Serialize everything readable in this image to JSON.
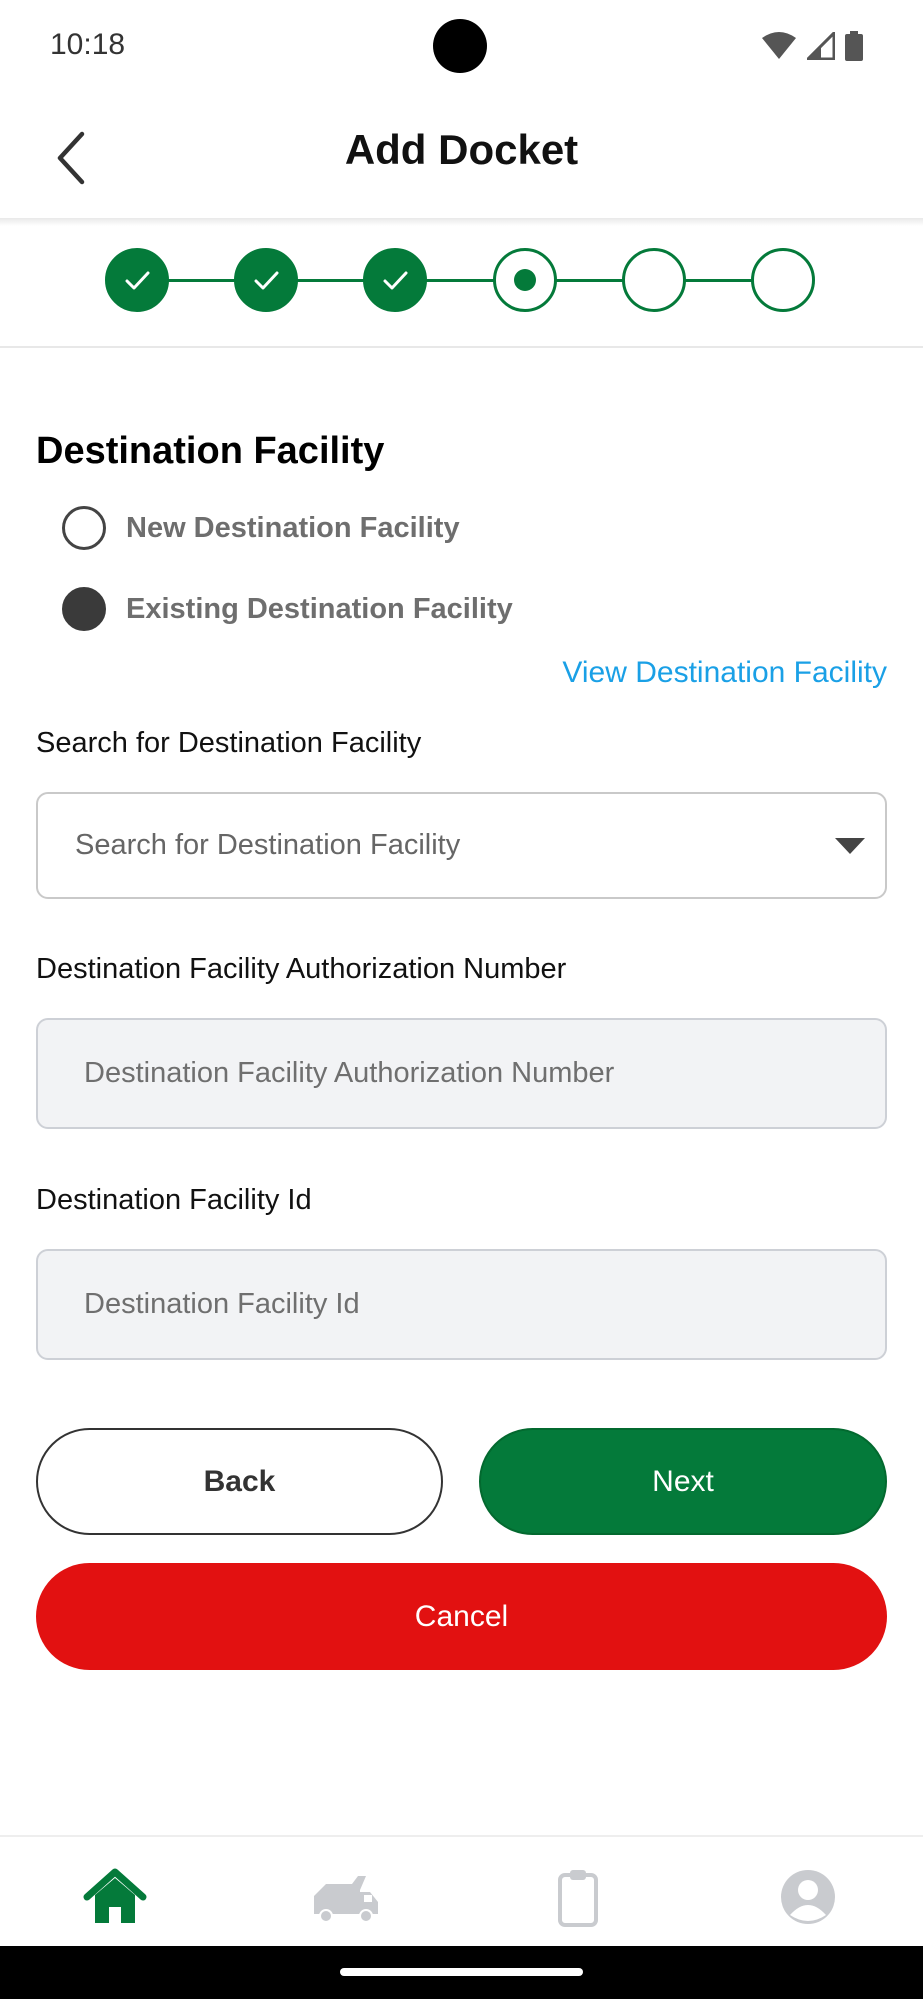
{
  "status_bar": {
    "time": "10:18"
  },
  "header": {
    "title": "Add Docket"
  },
  "stepper": {
    "steps": [
      "done",
      "done",
      "done",
      "current",
      "pending",
      "pending"
    ]
  },
  "section": {
    "title": "Destination Facility",
    "radio_new": "New Destination Facility",
    "radio_existing": "Existing Destination Facility",
    "selected": "existing",
    "view_link": "View Destination Facility"
  },
  "search": {
    "label": "Search for Destination Facility",
    "placeholder": "Search for Destination Facility"
  },
  "auth_number": {
    "label": "Destination Facility Authorization Number",
    "placeholder": "Destination Facility Authorization Number"
  },
  "facility_id": {
    "label": "Destination Facility Id",
    "placeholder": "Destination Facility Id"
  },
  "buttons": {
    "back": "Back",
    "next": "Next",
    "cancel": "Cancel"
  },
  "colors": {
    "primary_green": "#047a3a",
    "danger_red": "#e21111",
    "link_blue": "#1aa0e6"
  },
  "bottom_nav": [
    "home-icon",
    "truck-icon",
    "clipboard-icon",
    "profile-icon"
  ],
  "bottom_nav_active": "home-icon"
}
